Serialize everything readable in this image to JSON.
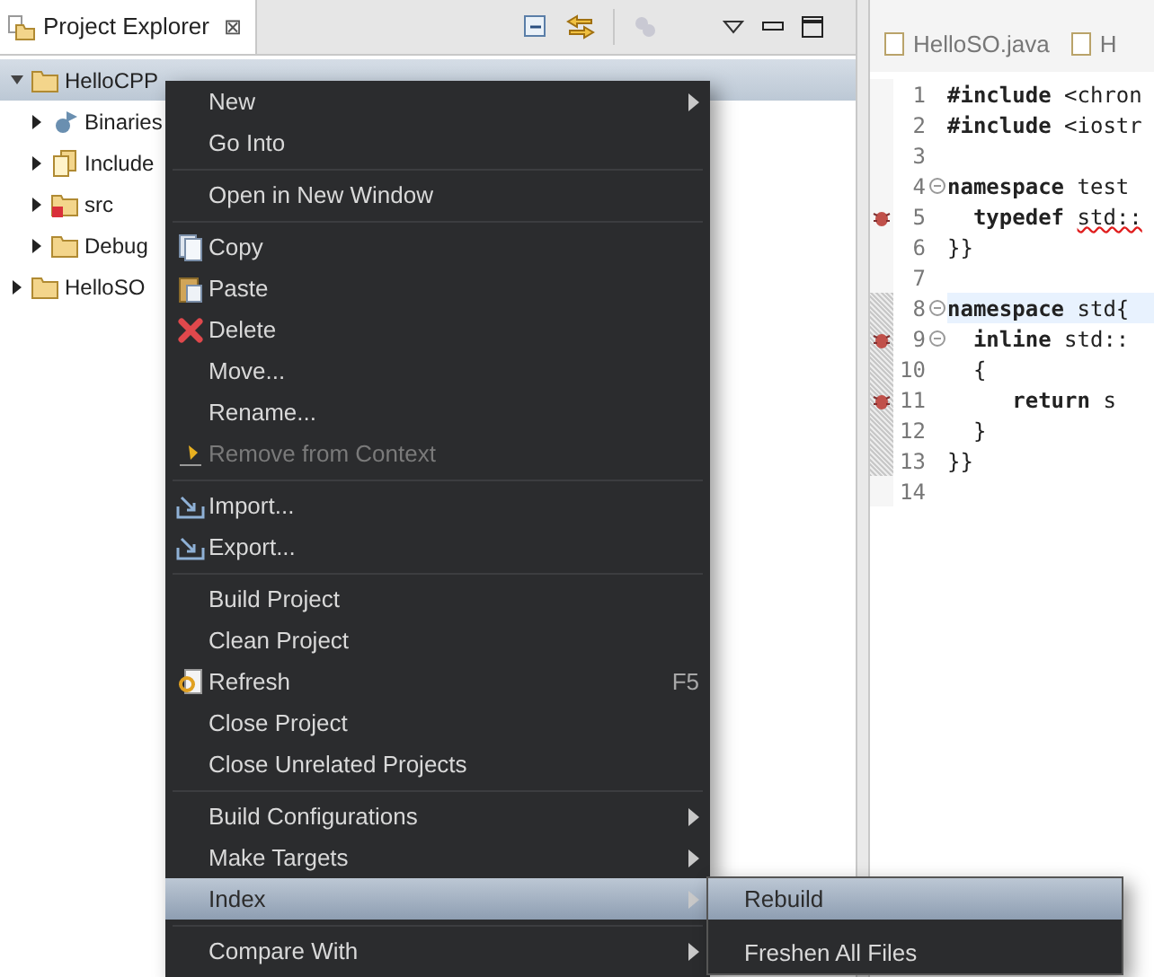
{
  "explorer": {
    "title": "Project Explorer",
    "close": "⊠"
  },
  "tree": [
    {
      "label": "HelloCPP",
      "selected": true,
      "expanded": true,
      "children": [
        {
          "label": "Binaries",
          "selected": false,
          "expanded": false
        },
        {
          "label": "Include",
          "selected": false,
          "expanded": false
        },
        {
          "label": "src",
          "selected": false,
          "expanded": false
        },
        {
          "label": "Debug",
          "selected": false,
          "expanded": false
        }
      ]
    },
    {
      "label": "HelloSO",
      "selected": false,
      "expanded": false
    }
  ],
  "editor_tabs": [
    {
      "label": "HelloSO.java"
    },
    {
      "label": "H"
    }
  ],
  "code_lines": [
    {
      "number": "1",
      "text": "**#include** <chron",
      "fold": false,
      "marker": false,
      "current": false,
      "scope": false
    },
    {
      "number": "2",
      "text": "**#include** <iostr",
      "fold": false,
      "marker": false,
      "current": false,
      "scope": false
    },
    {
      "number": "3",
      "fold": false,
      "marker": false,
      "current": false,
      "scope": false
    },
    {
      "number": "4",
      "text": "**namespace** test",
      "fold": true,
      "marker": false,
      "current": false,
      "scope": false
    },
    {
      "number": "5",
      "text": "  **typedef** ",
      "error_text": "std::",
      "fold": false,
      "marker": true,
      "current": false,
      "scope": false
    },
    {
      "number": "6",
      "text": "}}",
      "fold": false,
      "marker": false,
      "current": false,
      "scope": false
    },
    {
      "number": "7",
      "fold": false,
      "marker": false,
      "current": false,
      "scope": false
    },
    {
      "number": "8",
      "text": "**namespace** std{",
      "fold": true,
      "marker": false,
      "current": true,
      "scope": true
    },
    {
      "number": "9",
      "text": "  **inline** std::",
      "fold": true,
      "marker": true,
      "current": false,
      "scope": true
    },
    {
      "number": "10",
      "text": "  {",
      "fold": false,
      "marker": false,
      "current": false,
      "scope": true
    },
    {
      "number": "11",
      "text": "     **return** s",
      "fold": false,
      "marker": true,
      "current": false,
      "scope": true
    },
    {
      "number": "12",
      "text": "  }",
      "fold": false,
      "marker": false,
      "current": false,
      "scope": true
    },
    {
      "number": "13",
      "text": "}}",
      "fold": false,
      "marker": false,
      "current": false,
      "scope": true
    },
    {
      "number": "14",
      "fold": false,
      "marker": false,
      "current": false,
      "scope": false
    }
  ],
  "context_menu": [
    {
      "kind": "item",
      "label": "New",
      "submenu": true,
      "disabled": false,
      "selected": false
    },
    {
      "kind": "item",
      "label": "Go Into",
      "submenu": false,
      "disabled": false,
      "selected": false
    },
    {
      "kind": "separator"
    },
    {
      "kind": "item",
      "label": "Open in New Window",
      "submenu": false,
      "disabled": false,
      "selected": false
    },
    {
      "kind": "separator"
    },
    {
      "kind": "item",
      "label": "Copy",
      "submenu": false,
      "disabled": false,
      "selected": false
    },
    {
      "kind": "item",
      "label": "Paste",
      "submenu": false,
      "disabled": false,
      "selected": false
    },
    {
      "kind": "item",
      "label": "Delete",
      "submenu": false,
      "disabled": false,
      "selected": false
    },
    {
      "kind": "item",
      "label": "Move...",
      "submenu": false,
      "disabled": false,
      "selected": false
    },
    {
      "kind": "item",
      "label": "Rename...",
      "submenu": false,
      "disabled": false,
      "selected": false
    },
    {
      "kind": "item",
      "label": "Remove from Context",
      "submenu": false,
      "disabled": true,
      "selected": false
    },
    {
      "kind": "separator"
    },
    {
      "kind": "item",
      "label": "Import...",
      "submenu": false,
      "disabled": false,
      "selected": false
    },
    {
      "kind": "item",
      "label": "Export...",
      "submenu": false,
      "disabled": false,
      "selected": false
    },
    {
      "kind": "separator"
    },
    {
      "kind": "item",
      "label": "Build Project",
      "submenu": false,
      "disabled": false,
      "selected": false
    },
    {
      "kind": "item",
      "label": "Clean Project",
      "submenu": false,
      "disabled": false,
      "selected": false
    },
    {
      "kind": "item",
      "label": "Refresh",
      "shortcut": "F5",
      "submenu": false,
      "disabled": false,
      "selected": false
    },
    {
      "kind": "item",
      "label": "Close Project",
      "submenu": false,
      "disabled": false,
      "selected": false
    },
    {
      "kind": "item",
      "label": "Close Unrelated Projects",
      "submenu": false,
      "disabled": false,
      "selected": false
    },
    {
      "kind": "separator"
    },
    {
      "kind": "item",
      "label": "Build Configurations",
      "submenu": true,
      "disabled": false,
      "selected": false
    },
    {
      "kind": "item",
      "label": "Make Targets",
      "submenu": true,
      "disabled": false,
      "selected": false
    },
    {
      "kind": "item",
      "label": "Index",
      "submenu": true,
      "disabled": false,
      "selected": true
    },
    {
      "kind": "separator"
    },
    {
      "kind": "item",
      "label": "Compare With",
      "submenu": true,
      "disabled": false,
      "selected": false
    }
  ],
  "submenu": [
    {
      "kind": "item",
      "label": "Rebuild",
      "selected": true
    },
    {
      "kind": "separator"
    },
    {
      "kind": "item",
      "label": "Freshen All Files",
      "selected": false
    }
  ]
}
